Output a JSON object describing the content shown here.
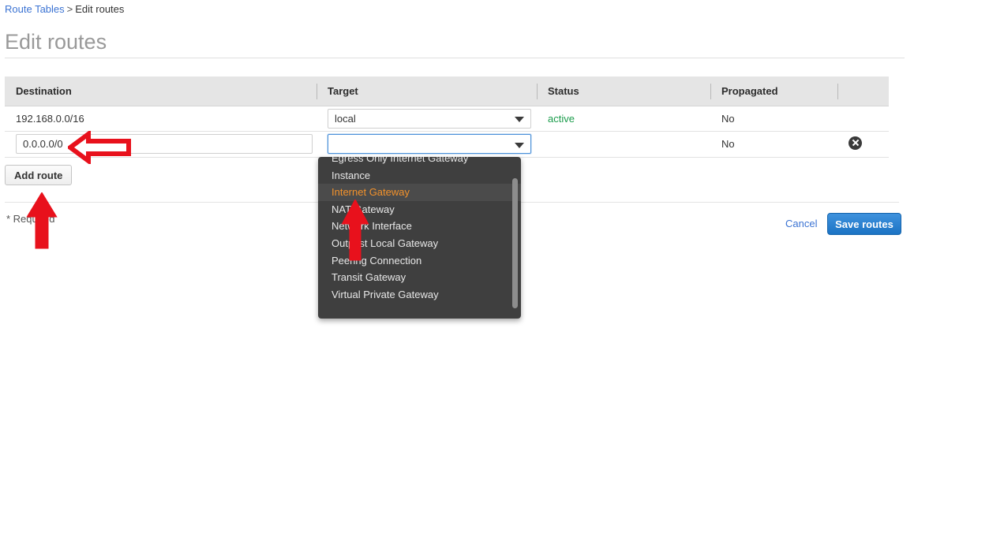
{
  "breadcrumb": {
    "link": "Route Tables",
    "separator": ">",
    "current": "Edit routes"
  },
  "page": {
    "title": "Edit routes"
  },
  "table": {
    "columns": [
      "Destination",
      "Target",
      "Status",
      "Propagated",
      ""
    ],
    "rows": [
      {
        "destination": "192.168.0.0/16",
        "target": "local",
        "status": "active",
        "propagated": "No",
        "removable": false
      },
      {
        "destination": "0.0.0.0/0",
        "target": "",
        "status": "",
        "propagated": "No",
        "removable": true
      }
    ]
  },
  "buttons": {
    "add_route": "Add route",
    "cancel": "Cancel",
    "save_routes": "Save routes"
  },
  "footer": {
    "required_note": "* Required"
  },
  "dropdown": {
    "open": true,
    "selected": "Internet Gateway",
    "options": [
      "Egress Only Internet Gateway",
      "Instance",
      "Internet Gateway",
      "NAT Gateway",
      "Network Interface",
      "Outpost Local Gateway",
      "Peering Connection",
      "Transit Gateway",
      "Virtual Private Gateway"
    ]
  },
  "annotations": [
    {
      "name": "arrow-to-destination-input",
      "direction": "left",
      "style": "outline"
    },
    {
      "name": "arrow-to-add-route-button",
      "direction": "up",
      "style": "solid"
    },
    {
      "name": "arrow-to-internet-gateway-option",
      "direction": "up",
      "style": "solid"
    }
  ],
  "colors": {
    "link": "#3b73d3",
    "status_active": "#1a9c4b",
    "dropdown_bg": "#3f3f3f",
    "dropdown_selected_text": "#f3922b",
    "primary_button": "#1b73c4",
    "annotation_red": "#e8111c",
    "header_bg": "#e5e5e5"
  }
}
